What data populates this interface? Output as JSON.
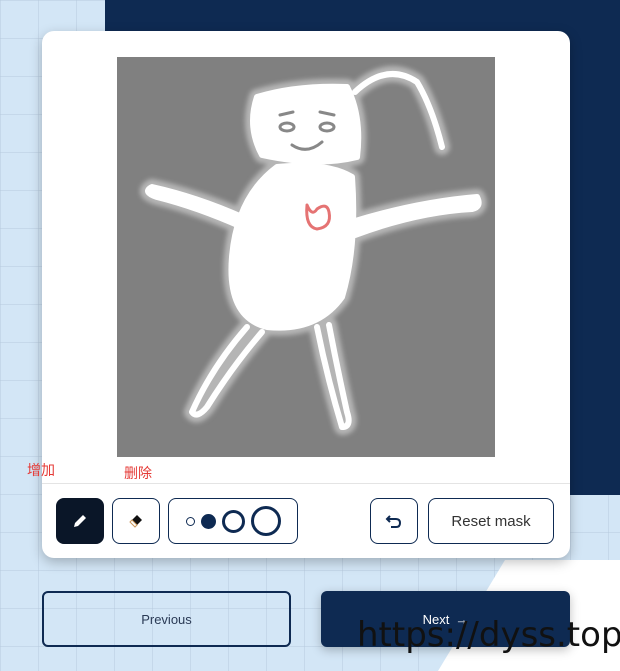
{
  "labels": {
    "add": "增加",
    "delete": "删除"
  },
  "toolbar": {
    "reset_label": "Reset mask",
    "brush_sizes": [
      "xs",
      "s",
      "m",
      "l"
    ],
    "active_tool": "draw"
  },
  "nav": {
    "previous": "Previous",
    "next": "Next",
    "next_arrow": "→"
  },
  "watermark": "https://dyss.top",
  "colors": {
    "navy": "#0e2a52",
    "canvas": "#808080",
    "heart": "#e57373"
  }
}
